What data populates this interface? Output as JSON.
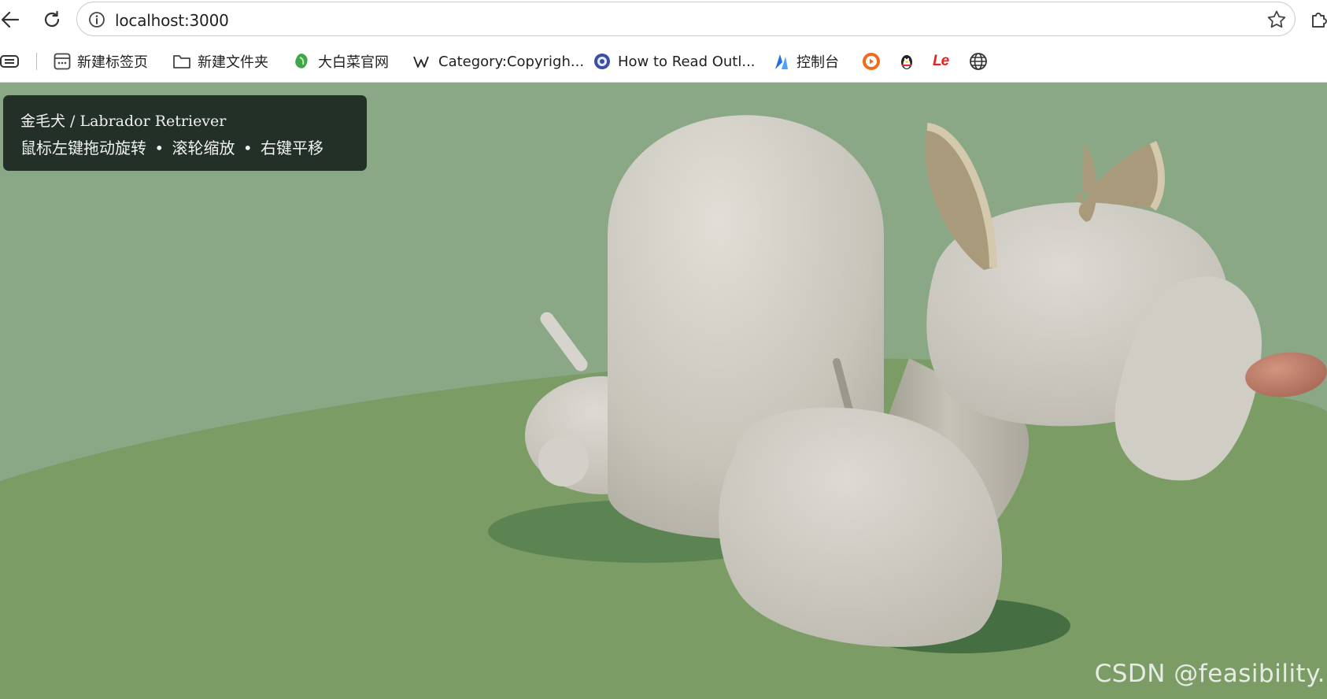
{
  "browser": {
    "url": "localhost:3000",
    "bookmarks": [
      {
        "label": "",
        "icon": "reading-list-icon"
      },
      {
        "label": "新建标签页",
        "icon": "new-tab-icon"
      },
      {
        "label": "新建文件夹",
        "icon": "folder-icon"
      },
      {
        "label": "大白菜官网",
        "icon": "cabbage-icon"
      },
      {
        "label": "Category:Copyrigh...",
        "icon": "wikipedia-icon"
      },
      {
        "label": "How to Read Outl...",
        "icon": "globe-gear-icon"
      },
      {
        "label": "控制台",
        "icon": "console-icon"
      },
      {
        "label": "",
        "icon": "orange-play-icon"
      },
      {
        "label": "",
        "icon": "penguin-icon"
      },
      {
        "label": "",
        "icon": "le-icon"
      },
      {
        "label": "",
        "icon": "globe-icon"
      }
    ],
    "bookmark_le_text": "Le"
  },
  "overlay": {
    "title": "金毛犬 / Labrador Retriever",
    "controls": "鼠标左键拖动旋转 • 滚轮缩放 • 右键平移"
  },
  "watermark": "CSDN @feasibility.",
  "colors": {
    "sky": "#8aa886",
    "ground": "#7c9c66",
    "dog_body": "#d2d0c8",
    "ear": "#a89a7a",
    "nose": "#c0806c",
    "panel": "#233028"
  }
}
